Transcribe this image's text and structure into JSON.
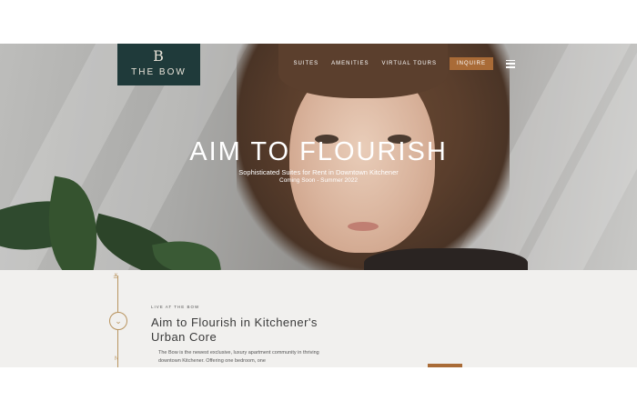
{
  "brand": {
    "mark": "B",
    "name": "THE BOW"
  },
  "nav": {
    "items": [
      {
        "label": "SUITES"
      },
      {
        "label": "AMENITIES"
      },
      {
        "label": "VIRTUAL TOURS"
      }
    ],
    "inquire_label": "INQUIRE",
    "menu_icon": "hamburger-menu-icon"
  },
  "hero": {
    "title": "AIM TO FLOURISH",
    "subtitle": "Sophisticated Suites for Rent in Downtown Kitchener",
    "tagline": "Coming Soon - Summer 2022"
  },
  "intro": {
    "eyebrow": "LIVE AT THE BOW",
    "title": "Aim to Flourish in Kitchener's Urban Core",
    "body": "The Bow is the newest exclusive, luxury apartment community in thriving downtown Kitchener. Offering one bedroom, one",
    "side_letter": "N",
    "scroll_icon": "chevron-down-icon"
  },
  "colors": {
    "logo_bg": "#1f3a3a",
    "accent": "#a96b37",
    "intro_bg": "#f1f0ee"
  }
}
